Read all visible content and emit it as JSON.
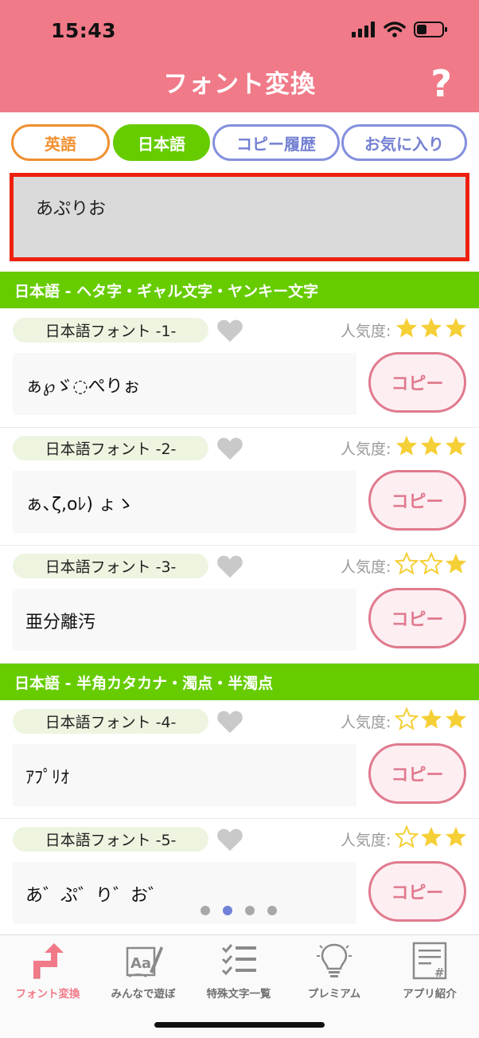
{
  "status_bar": {
    "time": "15:43"
  },
  "header": {
    "title": "フォント変換",
    "help_label": "?"
  },
  "tabs": [
    {
      "label": "英語"
    },
    {
      "label": "日本語"
    },
    {
      "label": "コピー履歴"
    },
    {
      "label": "お気に入り"
    }
  ],
  "input": {
    "value": "あぷりお"
  },
  "sections": [
    {
      "title": "日本語 - ヘタ字・ギャル文字・ヤンキー文字"
    },
    {
      "title": "日本語 - 半角カタカナ・濁点・半濁点"
    }
  ],
  "popularity_label": "人気度:",
  "copy_label": "コピー",
  "fonts": [
    {
      "name": "日本語フォント -1-",
      "preview": "ぁ℘ゞ◌ぺりぉ",
      "stars": 3
    },
    {
      "name": "日本語フォント -2-",
      "preview": "ぁ､ζ,oﾚ) ょゝ",
      "stars": 3
    },
    {
      "name": "日本語フォント -3-",
      "preview": "亜分離汚",
      "stars": 1
    },
    {
      "name": "日本語フォント -4-",
      "preview": "ｱﾌﾟﾘｵ",
      "stars": 2
    },
    {
      "name": "日本語フォント -5-",
      "preview": "あ゛ぷ゛り゛お゛",
      "stars": 2
    }
  ],
  "pager": {
    "count": 4,
    "active_index": 1
  },
  "tabbar": [
    {
      "label": "フォント変換",
      "icon": "convert-arrows-icon"
    },
    {
      "label": "みんなで遊ぼ",
      "icon": "paper-pencil-icon"
    },
    {
      "label": "特殊文字一覧",
      "icon": "checklist-icon"
    },
    {
      "label": "プレミアム",
      "icon": "lightbulb-icon"
    },
    {
      "label": "アプリ紹介",
      "icon": "document-hash-icon"
    }
  ],
  "colors": {
    "header": "#f07a88",
    "section_green": "#66cc00",
    "copy_pink": "#e07a8e",
    "tab_orange": "#f09030",
    "tab_purple": "#8590dd",
    "star_gold": "#f5cf36",
    "input_border_red": "#ee2010"
  }
}
